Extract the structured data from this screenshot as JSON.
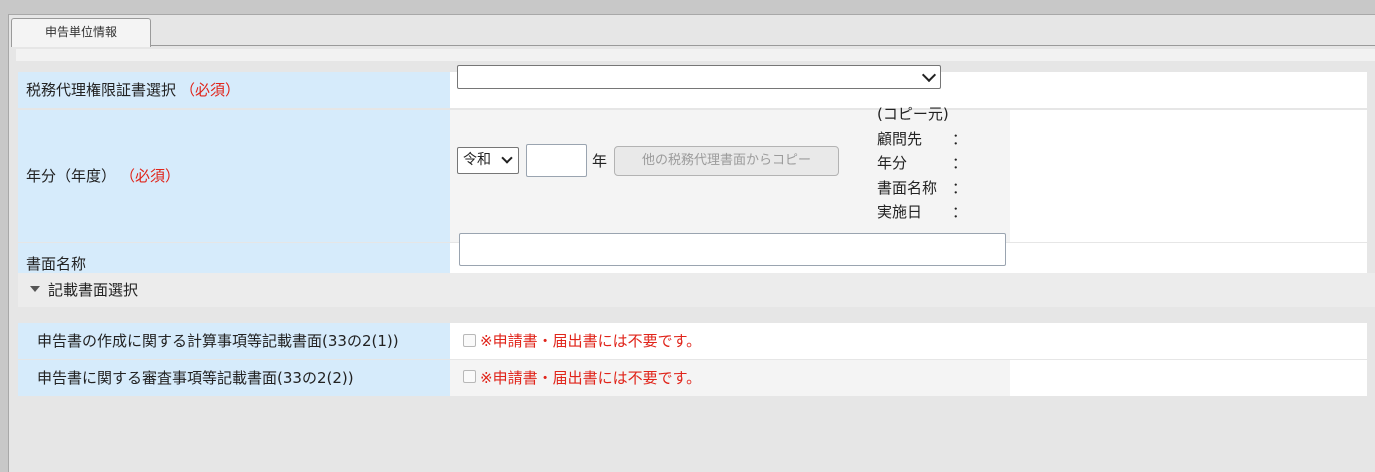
{
  "tab": {
    "label": "申告単位情報"
  },
  "fields": {
    "proxy_cert": {
      "label": "税務代理権限証書選択",
      "required": "（必須）",
      "selected_value": ""
    },
    "year": {
      "label": "年分（年度）",
      "required": "（必須）",
      "era_value": "令和",
      "year_value": "",
      "year_unit": "年",
      "copy_button": "他の税務代理書面からコピー"
    },
    "copy_source": {
      "title": "(コピー元)",
      "rows": [
        {
          "key": "顧問先",
          "sep": "："
        },
        {
          "key": "年分",
          "sep": "："
        },
        {
          "key": "書面名称",
          "sep": "："
        },
        {
          "key": "実施日",
          "sep": "："
        }
      ]
    },
    "document_name": {
      "label": "書面名称",
      "value": ""
    }
  },
  "section": {
    "title": "記載書面選択"
  },
  "options": [
    {
      "label": "申告書の作成に関する計算事項等記載書面(33の2(1))",
      "note": "※申請書・届出書には不要です。"
    },
    {
      "label": "申告書に関する審査事項等記載書面(33の2(2))",
      "note": "※申請書・届出書には不要です。"
    }
  ],
  "colors": {
    "label_bg": "#d6ebfb",
    "required": "#e0241a",
    "note": "#e0241a"
  }
}
